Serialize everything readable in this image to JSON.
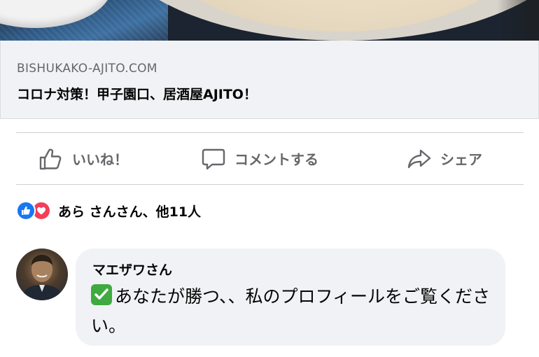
{
  "link_preview": {
    "domain": "BISHUKAKO-AJITO.COM",
    "title": "コロナ対策！甲子園口、居酒屋AJITO！"
  },
  "actions": {
    "like_label": "いいね！",
    "comment_label": "コメントする",
    "share_label": "シェア"
  },
  "reactions": {
    "summary": "あら さんさん、他11人",
    "icons": [
      "like-icon",
      "love-icon"
    ]
  },
  "comment": {
    "author": "マエザワさん",
    "body": "あなたが勝つ、、私のプロフィールをご覧ください。",
    "prefix_icon": "check-mark-icon"
  },
  "colors": {
    "like_blue": "#1877f2",
    "love_red": "#f33e58",
    "check_green": "#3faa3f",
    "muted_text": "#65676b"
  }
}
